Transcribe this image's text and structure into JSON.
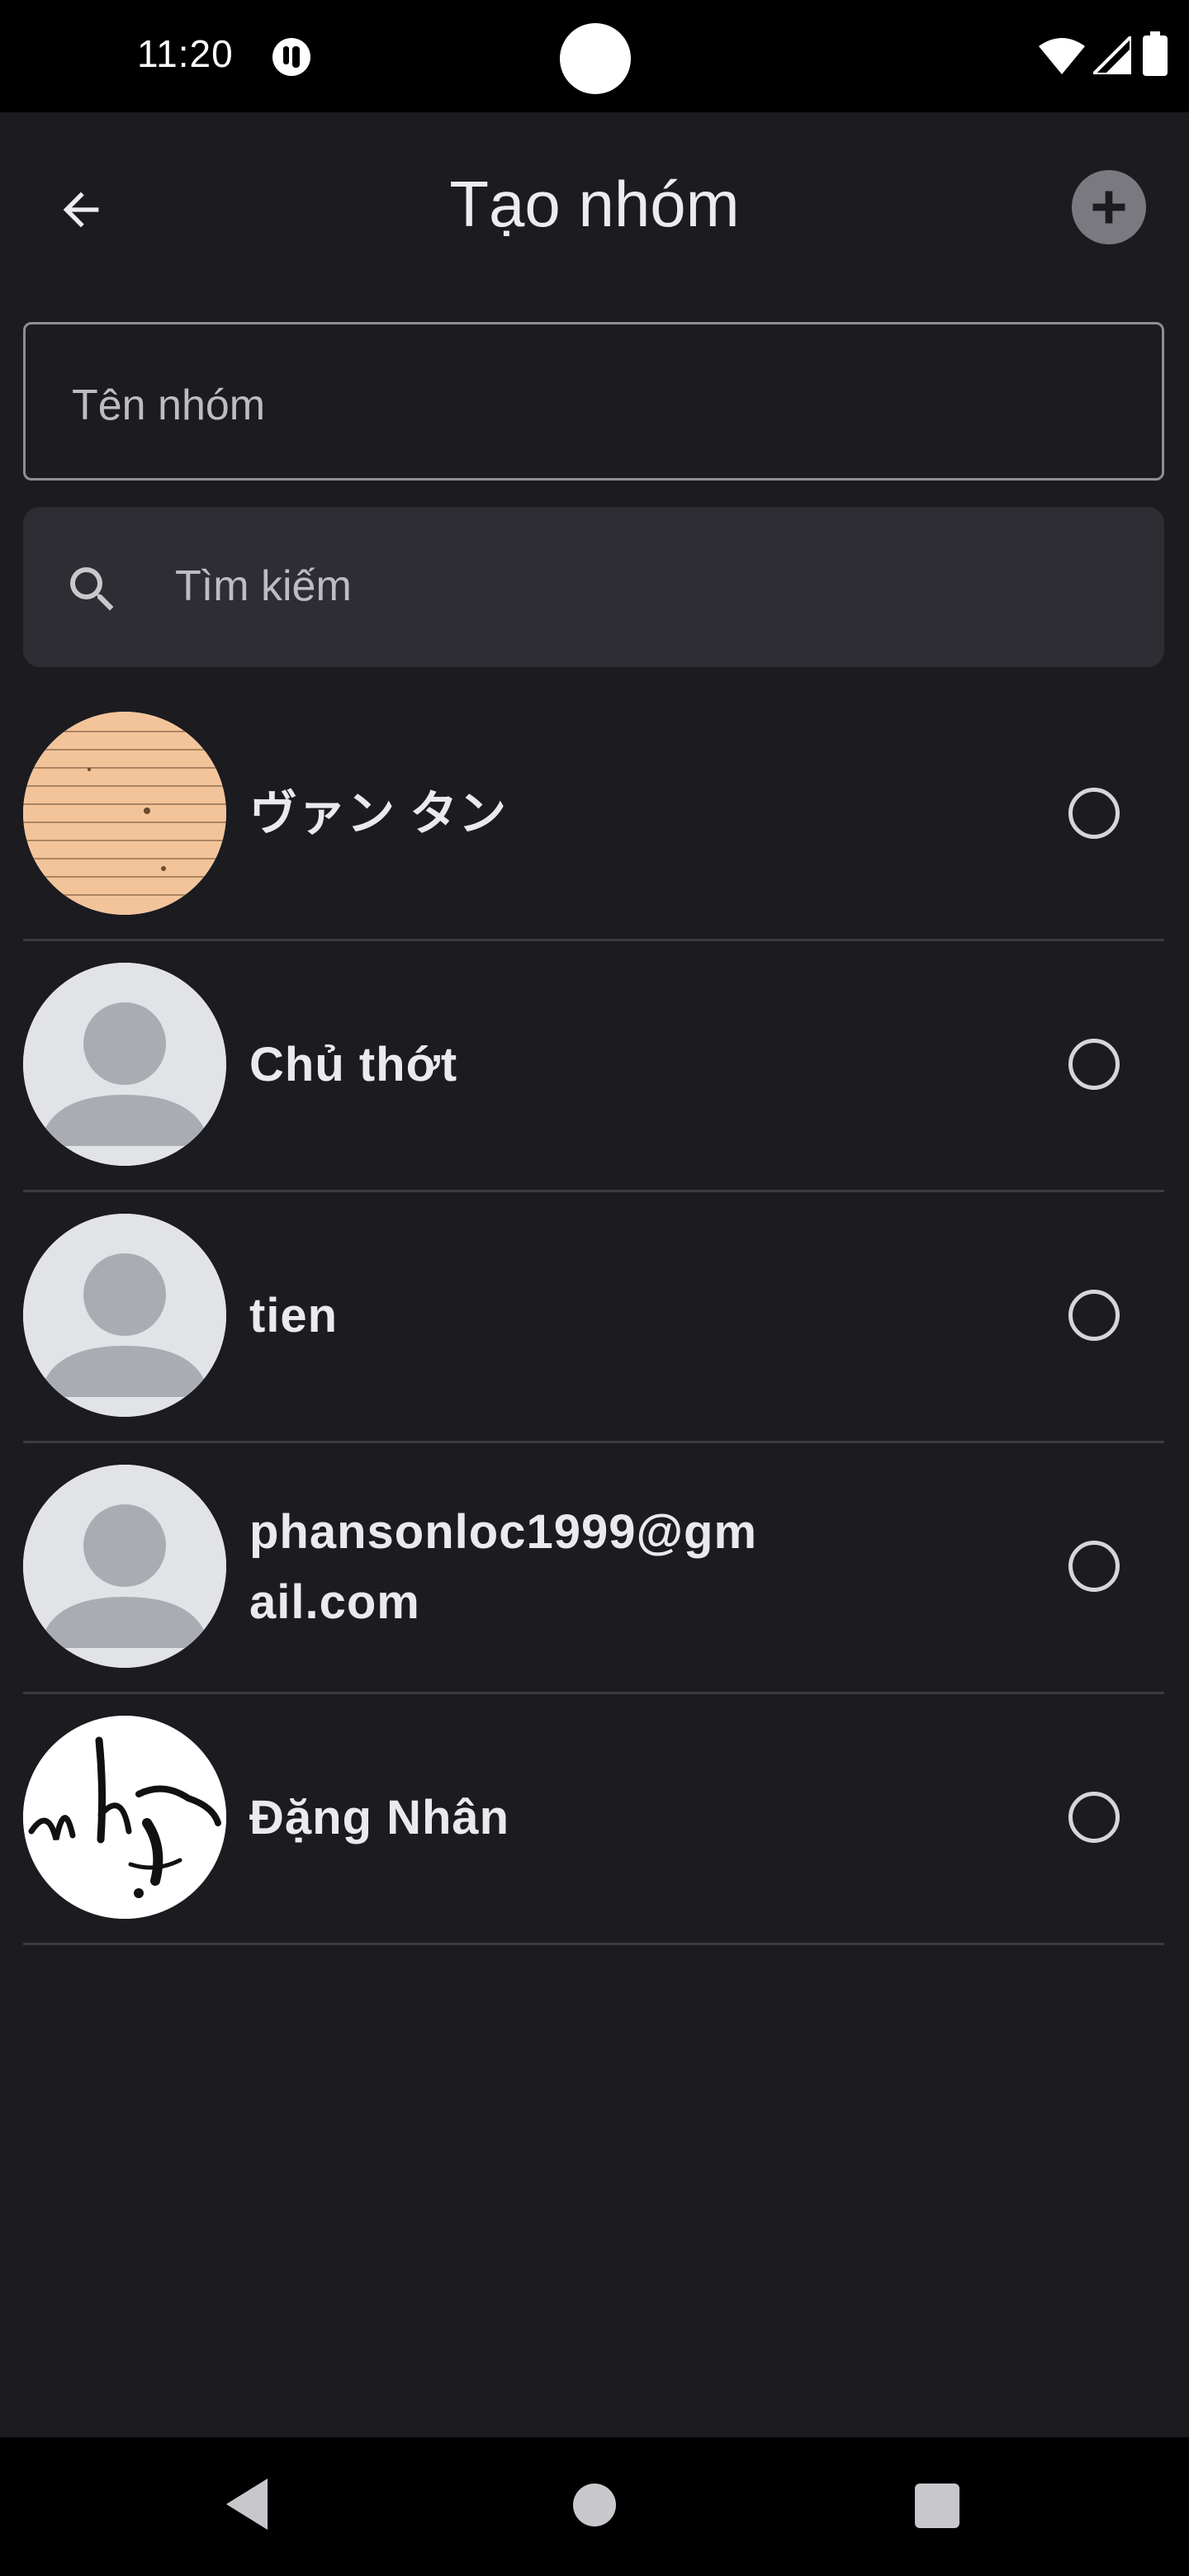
{
  "status_bar": {
    "time": "11:20"
  },
  "header": {
    "title": "Tạo nhóm",
    "back_icon": "arrow-left-icon",
    "add_icon": "plus-circle-icon"
  },
  "group_name": {
    "placeholder": "Tên nhóm"
  },
  "search": {
    "placeholder": "Tìm kiếm",
    "icon": "search-icon"
  },
  "contacts": [
    {
      "name": "ヴァン タン",
      "avatar": "wood-photo",
      "selected": false
    },
    {
      "name": "Chủ thớt",
      "avatar": "default-person",
      "selected": false
    },
    {
      "name": "tien",
      "avatar": "default-person",
      "selected": false
    },
    {
      "name_line1": "phansonloc1999@gm",
      "name_line2": "ail.com",
      "avatar": "default-person",
      "selected": false
    },
    {
      "name": "Đặng Nhân",
      "avatar": "calligraphy-image",
      "selected": false
    }
  ],
  "colors": {
    "background": "#1c1b20",
    "search_bg": "#2e2d33",
    "divider": "#3c3b41",
    "text": "#eaeaee"
  }
}
